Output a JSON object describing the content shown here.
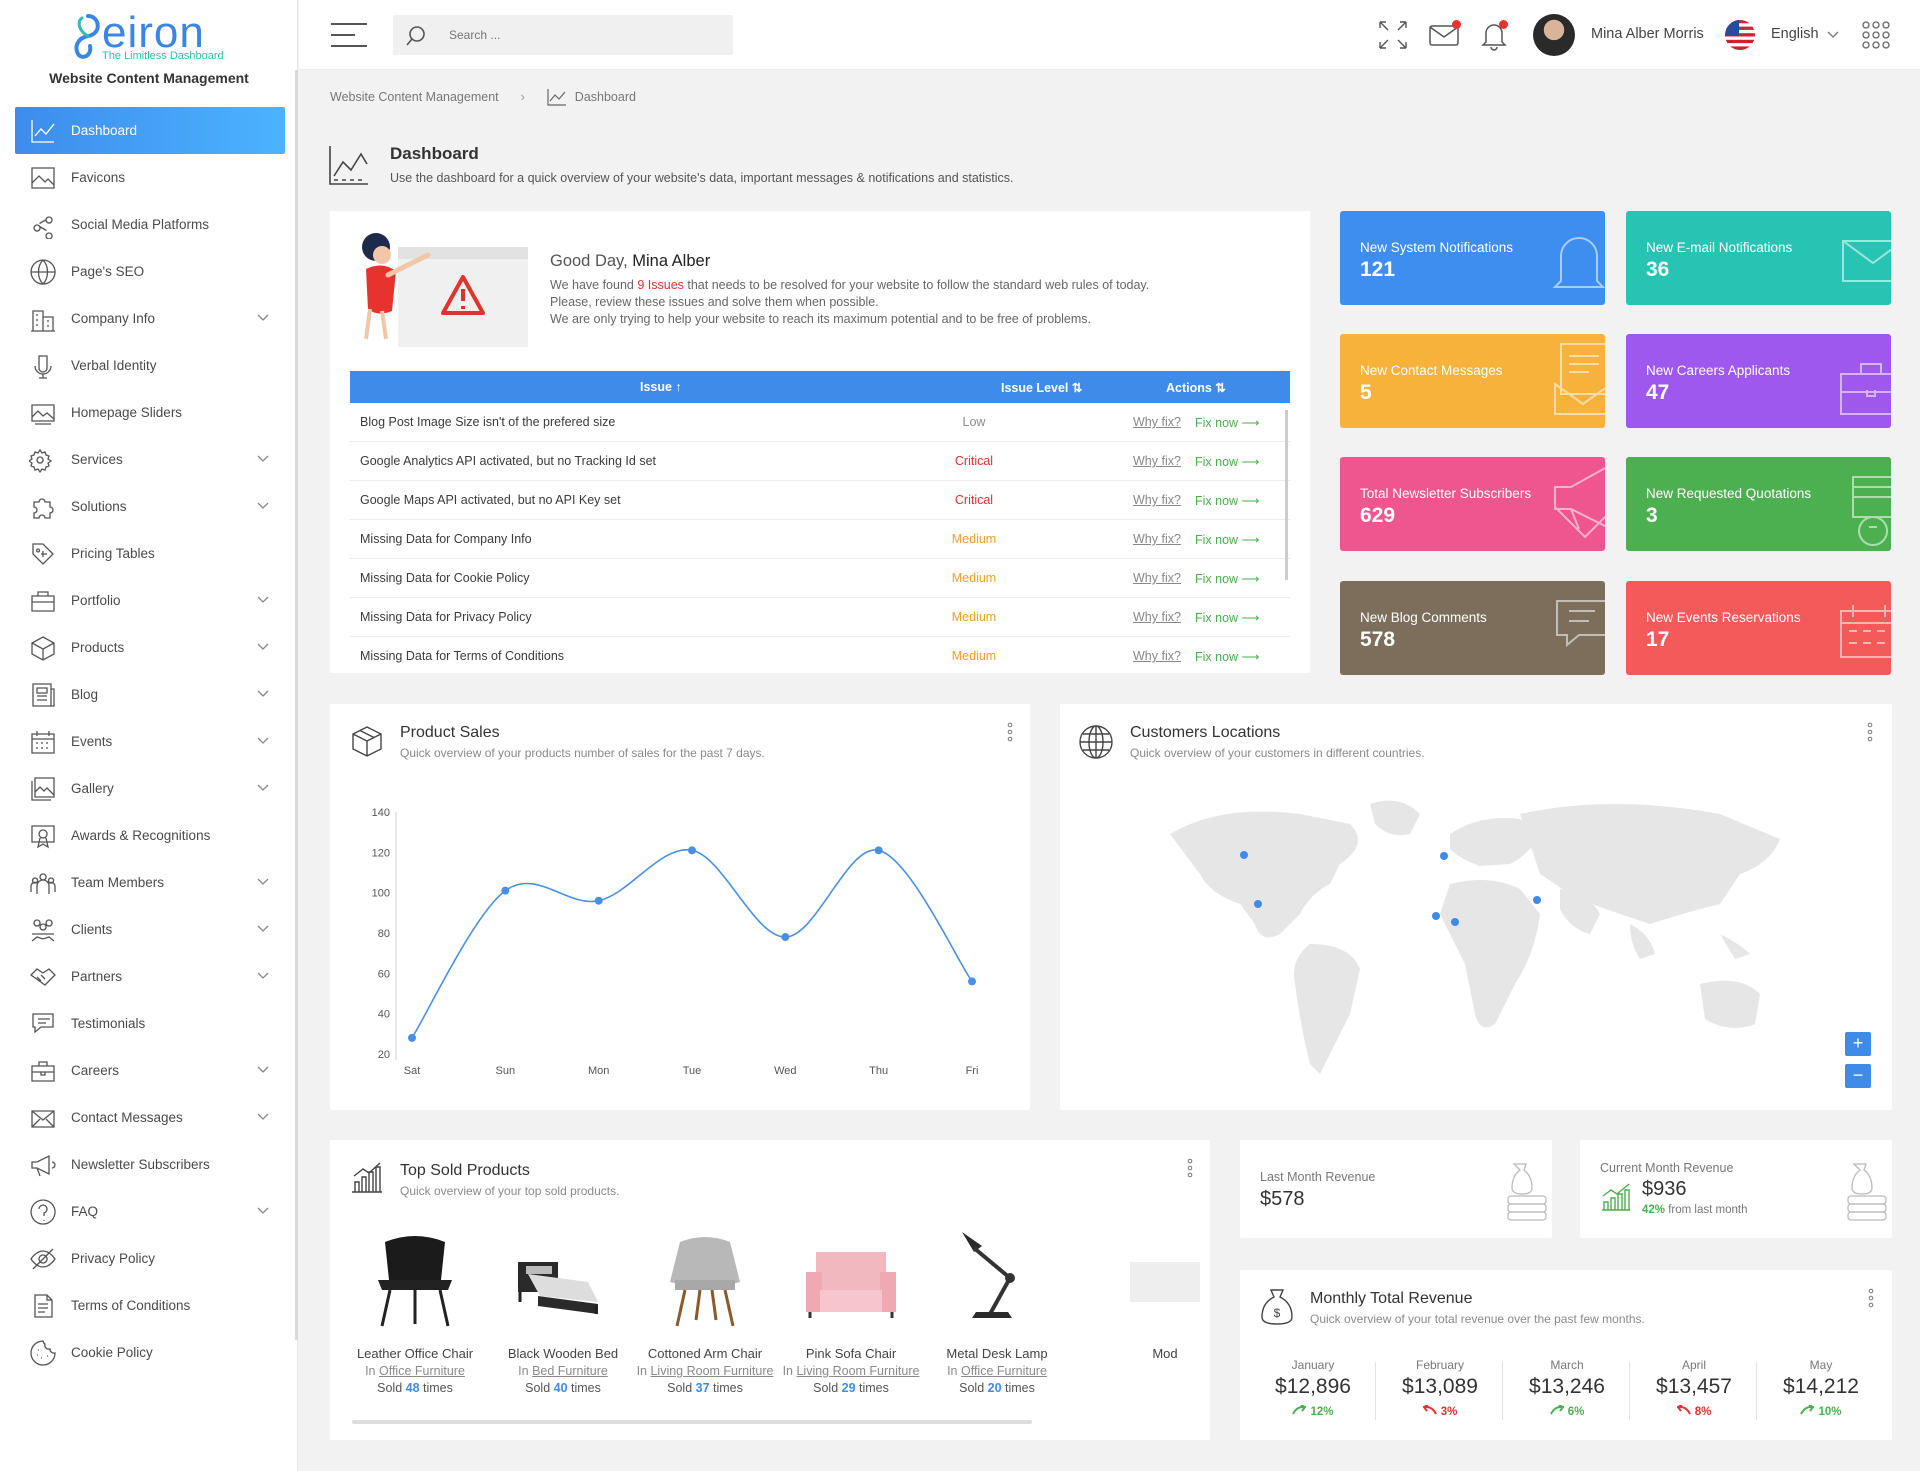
{
  "brand": {
    "name": "eiron",
    "tagline": "The Limitless Dashboard",
    "site_name": "Website Content Management"
  },
  "sidebar": {
    "items": [
      {
        "label": "Dashboard",
        "icon": "chart-line-icon",
        "active": true,
        "expandable": false
      },
      {
        "label": "Favicons",
        "icon": "image-icon",
        "expandable": false
      },
      {
        "label": "Social Media Platforms",
        "icon": "share-icon",
        "expandable": false
      },
      {
        "label": "Page's SEO",
        "icon": "globe-icon",
        "expandable": false
      },
      {
        "label": "Company Info",
        "icon": "building-icon",
        "expandable": true
      },
      {
        "label": "Verbal Identity",
        "icon": "microphone-icon",
        "expandable": false
      },
      {
        "label": "Homepage Sliders",
        "icon": "slides-icon",
        "expandable": false
      },
      {
        "label": "Services",
        "icon": "gears-icon",
        "expandable": true
      },
      {
        "label": "Solutions",
        "icon": "puzzle-icon",
        "expandable": true
      },
      {
        "label": "Pricing Tables",
        "icon": "price-tag-icon",
        "expandable": false
      },
      {
        "label": "Portfolio",
        "icon": "portfolio-icon",
        "expandable": true
      },
      {
        "label": "Products",
        "icon": "box-icon",
        "expandable": true
      },
      {
        "label": "Blog",
        "icon": "newspaper-icon",
        "expandable": true
      },
      {
        "label": "Events",
        "icon": "calendar-icon",
        "expandable": true
      },
      {
        "label": "Gallery",
        "icon": "gallery-icon",
        "expandable": true
      },
      {
        "label": "Awards & Recognitions",
        "icon": "award-icon",
        "expandable": false
      },
      {
        "label": "Team Members",
        "icon": "team-icon",
        "expandable": true
      },
      {
        "label": "Clients",
        "icon": "clients-icon",
        "expandable": true
      },
      {
        "label": "Partners",
        "icon": "handshake-icon",
        "expandable": true
      },
      {
        "label": "Testimonials",
        "icon": "chat-icon",
        "expandable": false
      },
      {
        "label": "Careers",
        "icon": "briefcase-icon",
        "expandable": true
      },
      {
        "label": "Contact Messages",
        "icon": "envelope-icon",
        "expandable": true
      },
      {
        "label": "Newsletter Subscribers",
        "icon": "megaphone-icon",
        "expandable": false
      },
      {
        "label": "FAQ",
        "icon": "question-icon",
        "expandable": true
      },
      {
        "label": "Privacy Policy",
        "icon": "eye-slash-icon",
        "expandable": false
      },
      {
        "label": "Terms of Conditions",
        "icon": "document-icon",
        "expandable": false
      },
      {
        "label": "Cookie Policy",
        "icon": "cookie-icon",
        "expandable": false
      }
    ]
  },
  "topbar": {
    "search_placeholder": "Search ...",
    "user_name": "Mina Alber Morris",
    "language": "English"
  },
  "breadcrumb": {
    "root": "Website Content Management",
    "current": "Dashboard"
  },
  "page": {
    "title": "Dashboard",
    "subtitle": "Use the dashboard for a quick overview of your website's data, important messages & notifications and statistics."
  },
  "greeting": {
    "prefix": "Good Day, ",
    "name": "Mina Alber",
    "line1_pre": "We have found ",
    "issues_count": "9 Issues",
    "line1_post": " that needs to be resolved for your website to follow the standard web rules of today.",
    "line2": "Please, review these issues and solve them when possible.",
    "line3": "We are only trying to help your website to reach its maximum potential and to be free of problems."
  },
  "issues": {
    "headers": {
      "issue": "Issue ↑",
      "level": "Issue Level ⇅",
      "actions": "Actions ⇅"
    },
    "why_label": "Why fix?",
    "fix_label": "Fix now ⟶",
    "rows": [
      {
        "issue": "Blog Post Image Size isn't of the prefered size",
        "level": "Low"
      },
      {
        "issue": "Google Analytics API activated, but no Tracking Id set",
        "level": "Critical"
      },
      {
        "issue": "Google Maps API activated, but no API Key set",
        "level": "Critical"
      },
      {
        "issue": "Missing Data for Company Info",
        "level": "Medium"
      },
      {
        "issue": "Missing Data for Cookie Policy",
        "level": "Medium"
      },
      {
        "issue": "Missing Data for Privacy Policy",
        "level": "Medium"
      },
      {
        "issue": "Missing Data for Terms of Conditions",
        "level": "Medium"
      }
    ]
  },
  "stats": [
    {
      "label": "New System Notifications",
      "value": "121",
      "color": "#3e8ef0",
      "icon": "bell-icon"
    },
    {
      "label": "New E-mail Notifications",
      "value": "36",
      "color": "#27c4b4",
      "icon": "envelope-icon"
    },
    {
      "label": "New Contact Messages",
      "value": "5",
      "color": "#f7b23b",
      "icon": "contact-message-icon"
    },
    {
      "label": "New Careers Applicants",
      "value": "47",
      "color": "#9f58ee",
      "icon": "briefcase-icon"
    },
    {
      "label": "Total Newsletter Subscribers",
      "value": "629",
      "color": "#ef5690",
      "icon": "megaphone-icon"
    },
    {
      "label": "New Requested Quotations",
      "value": "3",
      "color": "#4caf50",
      "icon": "money-icon"
    },
    {
      "label": "New Blog Comments",
      "value": "578",
      "color": "#7c6e5b",
      "icon": "comment-icon"
    },
    {
      "label": "New Events Reservations",
      "value": "17",
      "color": "#f45a5a",
      "icon": "calendar-icon"
    }
  ],
  "product_sales": {
    "title": "Product Sales",
    "subtitle": "Quick overview of your products number of sales for the past 7 days."
  },
  "chart_data": {
    "type": "line",
    "categories": [
      "Sat",
      "Sun",
      "Mon",
      "Tue",
      "Wed",
      "Thu",
      "Fri"
    ],
    "values": [
      28,
      101,
      96,
      121,
      78,
      121,
      56
    ],
    "ylim": [
      20,
      140
    ],
    "yticks": [
      20,
      40,
      60,
      80,
      100,
      120,
      140
    ],
    "color": "#4a90e2",
    "grid": false
  },
  "locations": {
    "title": "Customers Locations",
    "subtitle": "Quick overview of your customers in different countries.",
    "zoom_in": "+",
    "zoom_out": "−"
  },
  "top_sold": {
    "title": "Top Sold Products",
    "subtitle": "Quick overview of your top sold products.",
    "in_label": "In ",
    "sold_label": "Sold ",
    "times_label": " times",
    "products": [
      {
        "name": "Leather Office Chair",
        "category": "Office Furniture",
        "sold": "48"
      },
      {
        "name": "Black Wooden Bed",
        "category": "Bed Furniture",
        "sold": "40"
      },
      {
        "name": "Cottoned Arm Chair",
        "category": "Living Room Furniture",
        "sold": "37"
      },
      {
        "name": "Pink Sofa Chair",
        "category": "Living Room Furniture",
        "sold": "29"
      },
      {
        "name": "Metal Desk Lamp",
        "category": "Office Furniture",
        "sold": "20"
      },
      {
        "name": "Mod",
        "category": "",
        "sold": ""
      }
    ]
  },
  "revenue": {
    "last_label": "Last Month Revenue",
    "last_value": "$578",
    "current_label": "Current Month Revenue",
    "current_value": "$936",
    "change": "42%",
    "change_text": " from last month"
  },
  "monthly": {
    "title": "Monthly Total Revenue",
    "subtitle": "Quick overview of your total revenue over the past few months.",
    "months": [
      {
        "name": "January",
        "value": "$12,896",
        "pct": "12%",
        "dir": "up"
      },
      {
        "name": "February",
        "value": "$13,089",
        "pct": "3%",
        "dir": "down"
      },
      {
        "name": "March",
        "value": "$13,246",
        "pct": "6%",
        "dir": "up"
      },
      {
        "name": "April",
        "value": "$13,457",
        "pct": "8%",
        "dir": "down"
      },
      {
        "name": "May",
        "value": "$14,212",
        "pct": "10%",
        "dir": "up"
      }
    ]
  }
}
